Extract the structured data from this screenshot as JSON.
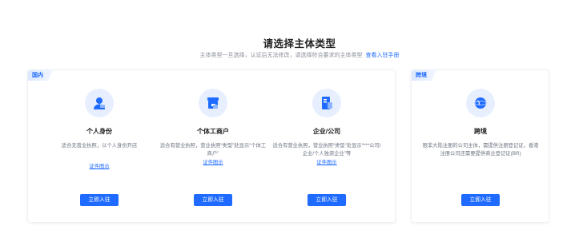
{
  "header": {
    "title": "请选择主体类型",
    "subtitle": "主体类型一旦选择，认证后无法修改，请选择符合要求的主体类型",
    "manual_link": "查看入驻手册"
  },
  "panels": {
    "domestic": {
      "tag": "国内",
      "cards": [
        {
          "name": "个人身份",
          "desc": "适合无营业执照，以个人身份开店",
          "cert_link": "证件图示",
          "button": "立即入驻",
          "icon": "person-icon"
        },
        {
          "name": "个体工商户",
          "desc": "适合有营业执照，营业执照“类型”处显示“个体工商户”",
          "cert_link": "证件图示",
          "button": "立即入驻",
          "icon": "store-icon"
        },
        {
          "name": "企业/公司",
          "desc": "适合有营业执照，营业执照“类型”处显示“***公司/企业/个人独资企业”等",
          "cert_link": "证件图示",
          "button": "立即入驻",
          "icon": "company-icon"
        }
      ]
    },
    "cross_border": {
      "tag": "跨境",
      "card": {
        "name": "跨境",
        "desc": "限非大陆注册的公司主体，需提供注册登记证，香港注册公司还需要提供商业登记证(BR)",
        "button": "立即入驻",
        "icon": "globe-icon"
      }
    }
  },
  "colors": {
    "accent": "#1f6bff",
    "icon_bg": "#e7efff",
    "tag_bg": "#dbe8ff"
  }
}
